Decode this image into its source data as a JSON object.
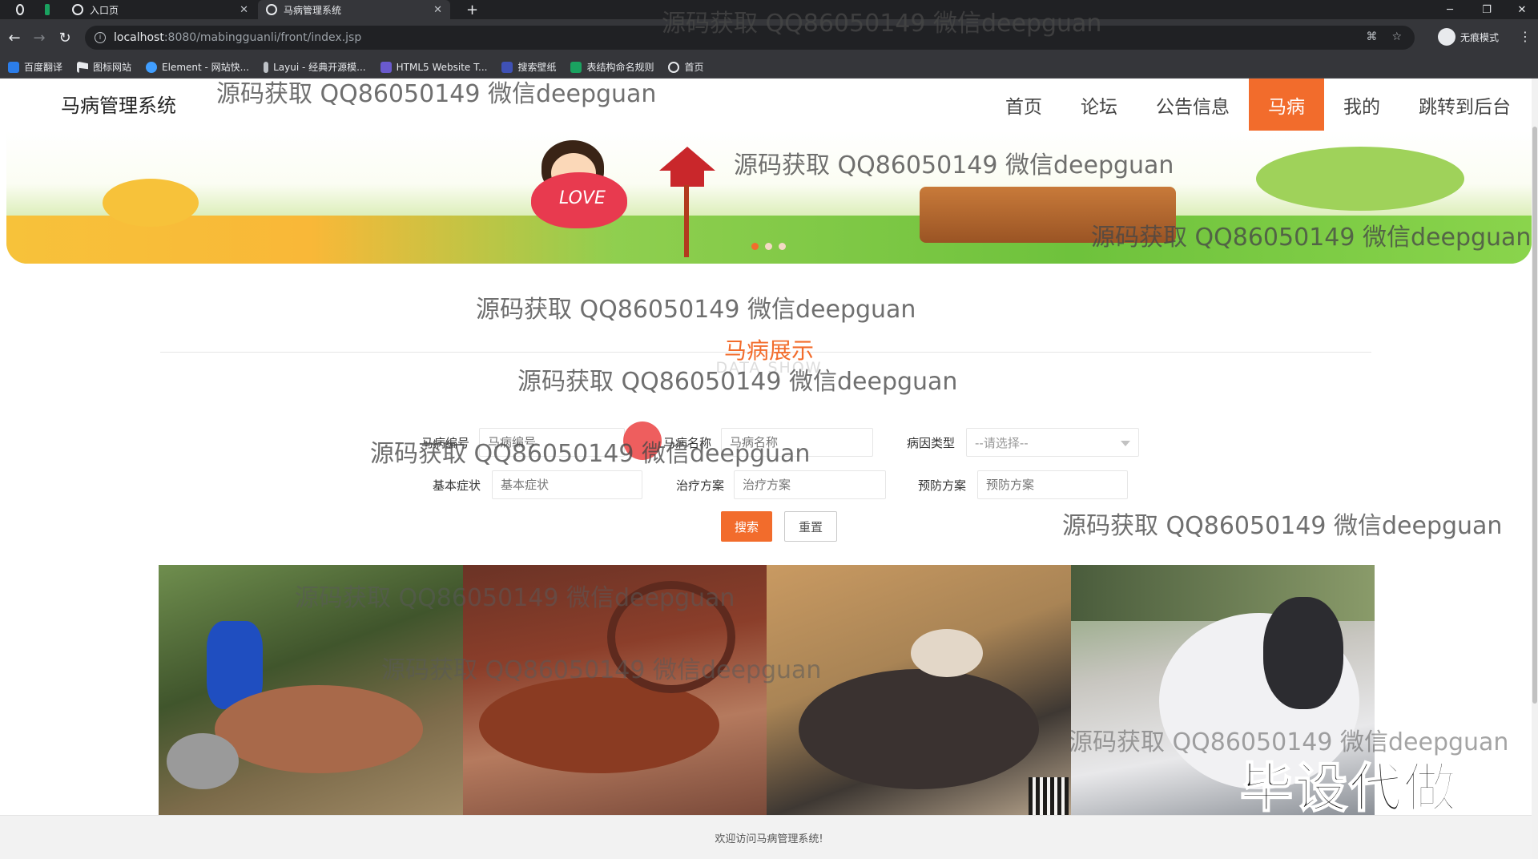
{
  "browser": {
    "tabs": [
      {
        "title": "入口页",
        "active": false
      },
      {
        "title": "马病管理系统",
        "active": true
      }
    ],
    "new_tab": "+",
    "url_host": "localhost",
    "url_path": ":8080/mabingguanli/front/index.jsp",
    "profile_label": "无痕模式",
    "bookmarks": [
      "百度翻译",
      "图标网站",
      "Element - 网站快...",
      "Layui - 经典开源模...",
      "HTML5 Website T...",
      "搜索壁纸",
      "表结构命名规则",
      "首页"
    ]
  },
  "site": {
    "title": "马病管理系统",
    "nav": [
      {
        "label": "首页",
        "active": false
      },
      {
        "label": "论坛",
        "active": false
      },
      {
        "label": "公告信息",
        "active": false
      },
      {
        "label": "马病",
        "active": true
      },
      {
        "label": "我的",
        "active": false
      },
      {
        "label": "跳转到后台",
        "active": false
      }
    ]
  },
  "banner": {
    "heart_text": "LOVE",
    "slides": 3,
    "active_slide": 0
  },
  "section": {
    "title": "马病展示",
    "subtitle": "DATA SHOW"
  },
  "search": {
    "fields": [
      {
        "label": "马病编号",
        "placeholder": "马病编号"
      },
      {
        "label": "马病名称",
        "placeholder": "马病名称"
      },
      {
        "label": "病因类型",
        "placeholder": "--请选择--"
      },
      {
        "label": "基本症状",
        "placeholder": "基本症状"
      },
      {
        "label": "治疗方案",
        "placeholder": "治疗方案"
      },
      {
        "label": "预防方案",
        "placeholder": "预防方案"
      }
    ],
    "search_button": "搜索",
    "reset_button": "重置"
  },
  "footer": {
    "text": "欢迎访问马病管理系统!"
  },
  "overlay": {
    "watermark": "源码获取 QQ86050149 微信deepguan",
    "big_text": "毕设代做"
  },
  "colors": {
    "accent": "#f26c2c",
    "chrome_dark": "#202124",
    "chrome_mid": "#35363a"
  }
}
